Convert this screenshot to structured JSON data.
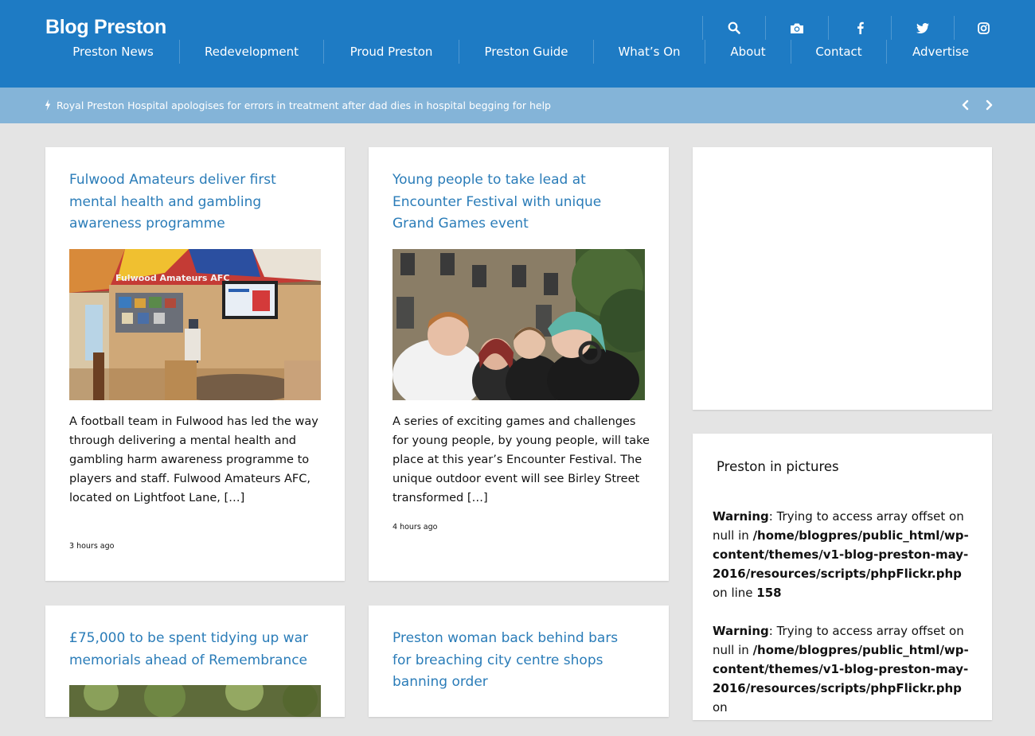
{
  "site": {
    "logo": "Blog Preston",
    "brand_color": "#1e7bc4",
    "ticker_color": "#84b4d8",
    "title_color": "#2a7cb8"
  },
  "header_icons": [
    {
      "name": "search-icon"
    },
    {
      "name": "camera-icon"
    },
    {
      "name": "facebook-icon"
    },
    {
      "name": "twitter-icon"
    },
    {
      "name": "instagram-icon"
    }
  ],
  "nav": [
    {
      "label": "Preston News"
    },
    {
      "label": "Redevelopment"
    },
    {
      "label": "Proud Preston"
    },
    {
      "label": "Preston Guide"
    },
    {
      "label": "What’s On"
    },
    {
      "label": "About"
    },
    {
      "label": "Contact"
    },
    {
      "label": "Advertise"
    }
  ],
  "ticker": {
    "icon": "lightning-icon",
    "text": "Royal Preston Hospital apologises for errors in treatment after dad dies in hospital begging for help",
    "prev_icon": "chevron-left-icon",
    "next_icon": "chevron-right-icon"
  },
  "articles": [
    {
      "title": "Fulwood Amateurs deliver first mental health and gambling awareness programme",
      "excerpt": "A football team in Fulwood has led the way through delivering a mental health and gambling harm awareness programme to players and staff. Fulwood Amateurs AFC, located on Lightfoot Lane, […]",
      "time": "3 hours ago",
      "image_text": "Fulwood Amateurs AFC"
    },
    {
      "title": "Young people to take lead at Encounter Festival with unique Grand Games event",
      "excerpt": "A series of exciting games and challenges for young people, by young people, will take place at this year’s Encounter Festival. The unique outdoor event will see Birley Street transformed […]",
      "time": "4 hours ago"
    },
    {
      "title": "£75,000 to be spent tidying up war memorials ahead of Remembrance"
    },
    {
      "title": "Preston woman back behind bars for breaching city centre shops banning order"
    }
  ],
  "sidebar": {
    "widget_title": "Preston in pictures",
    "warnings": [
      {
        "label": "Warning",
        "message": ": Trying to access array offset on null in ",
        "path": "/home/blogpres/public_html/wp-content/themes/v1-blog-preston-may-2016/resources/scripts/phpFlickr.php",
        "line_text": " on line ",
        "line": "158"
      },
      {
        "label": "Warning",
        "message": ": Trying to access array offset on null in ",
        "path": "/home/blogpres/public_html/wp-content/themes/v1-blog-preston-may-2016/resources/scripts/phpFlickr.php",
        "line_text": " on",
        "line": ""
      }
    ]
  }
}
